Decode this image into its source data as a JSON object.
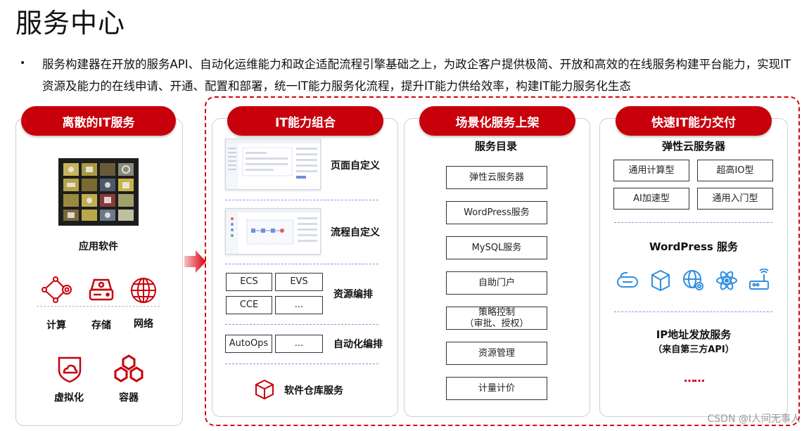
{
  "page": {
    "title": "服务中心",
    "intro": "服务构建器在开放的服务API、自动化运维能力和政企适配流程引擎基础之上，为政企客户提供极简、开放和高效的在线服务构建平台能力，实现IT资源及能力的在线申请、开通、配置和部署，统一IT能力服务化流程，提升IT能力供给效率，构建IT能力服务化生态"
  },
  "colors": {
    "accent": "#c7000b",
    "dashed": "#d9000d",
    "divider": "#7a9bd6"
  },
  "col1": {
    "header": "离散的IT服务",
    "app_label": "应用软件",
    "icons": [
      {
        "icon": "compute-icon",
        "label": "计算"
      },
      {
        "icon": "storage-icon",
        "label": "存储"
      },
      {
        "icon": "network-icon",
        "label": "网络"
      },
      {
        "icon": "virtualization-icon",
        "label": "虚拟化"
      },
      {
        "icon": "container-icon",
        "label": "容器"
      }
    ]
  },
  "col2": {
    "header": "IT能力组合",
    "page_custom": "页面自定义",
    "flow_custom": "流程自定义",
    "resources": {
      "label": "资源编排",
      "items": [
        "ECS",
        "EVS",
        "CCE",
        "..."
      ]
    },
    "automation": {
      "label": "自动化编排",
      "items": [
        "AutoOps",
        "..."
      ]
    },
    "repo": {
      "label": "软件仓库服务",
      "icon": "cube-icon"
    }
  },
  "col3": {
    "header": "场景化服务上架",
    "subtitle": "服务目录",
    "items": [
      "弹性云服务器",
      "WordPress服务",
      "MySQL服务",
      "自助门户",
      "策略控制\n（审批、授权）",
      "资源管理",
      "计量计价"
    ]
  },
  "col4": {
    "header": "快速IT能力交付",
    "ecs_title": "弹性云服务器",
    "ecs_types": [
      "通用计算型",
      "超高IO型",
      "AI加速型",
      "通用入门型"
    ],
    "wordpress_title": "WordPress 服务",
    "wordpress_icons": [
      "cloud-box-icon",
      "cube-icon",
      "globe-gear-icon",
      "atom-icon",
      "router-icon"
    ],
    "ip_title": "IP地址发放服务",
    "ip_sub": "（来自第三方API）",
    "ellipsis": "……"
  },
  "watermark": "CSDN @I人间无事人"
}
